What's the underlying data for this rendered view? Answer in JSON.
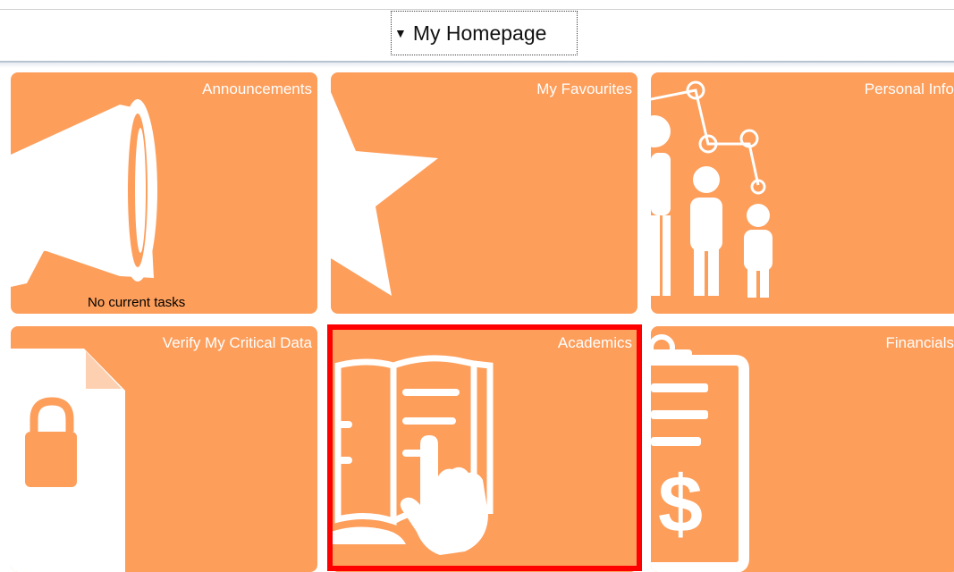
{
  "header": {
    "page_selector_label": "My Homepage"
  },
  "tiles": [
    {
      "title": "Announcements",
      "status": "No current tasks",
      "icon": "megaphone-icon"
    },
    {
      "title": "My Favourites",
      "icon": "star-icon"
    },
    {
      "title": "Personal Info",
      "icon": "family-icon"
    },
    {
      "title": "Verify My Critical Data",
      "icon": "locked-document-icon"
    },
    {
      "title": "Academics",
      "icon": "book-icon",
      "selected": true
    },
    {
      "title": "Financials",
      "icon": "clipboard-dollar-icon"
    }
  ],
  "colors": {
    "tile_bg": "#fd9e5b",
    "icon_fg": "#ffffff",
    "selection": "#ff0000"
  }
}
